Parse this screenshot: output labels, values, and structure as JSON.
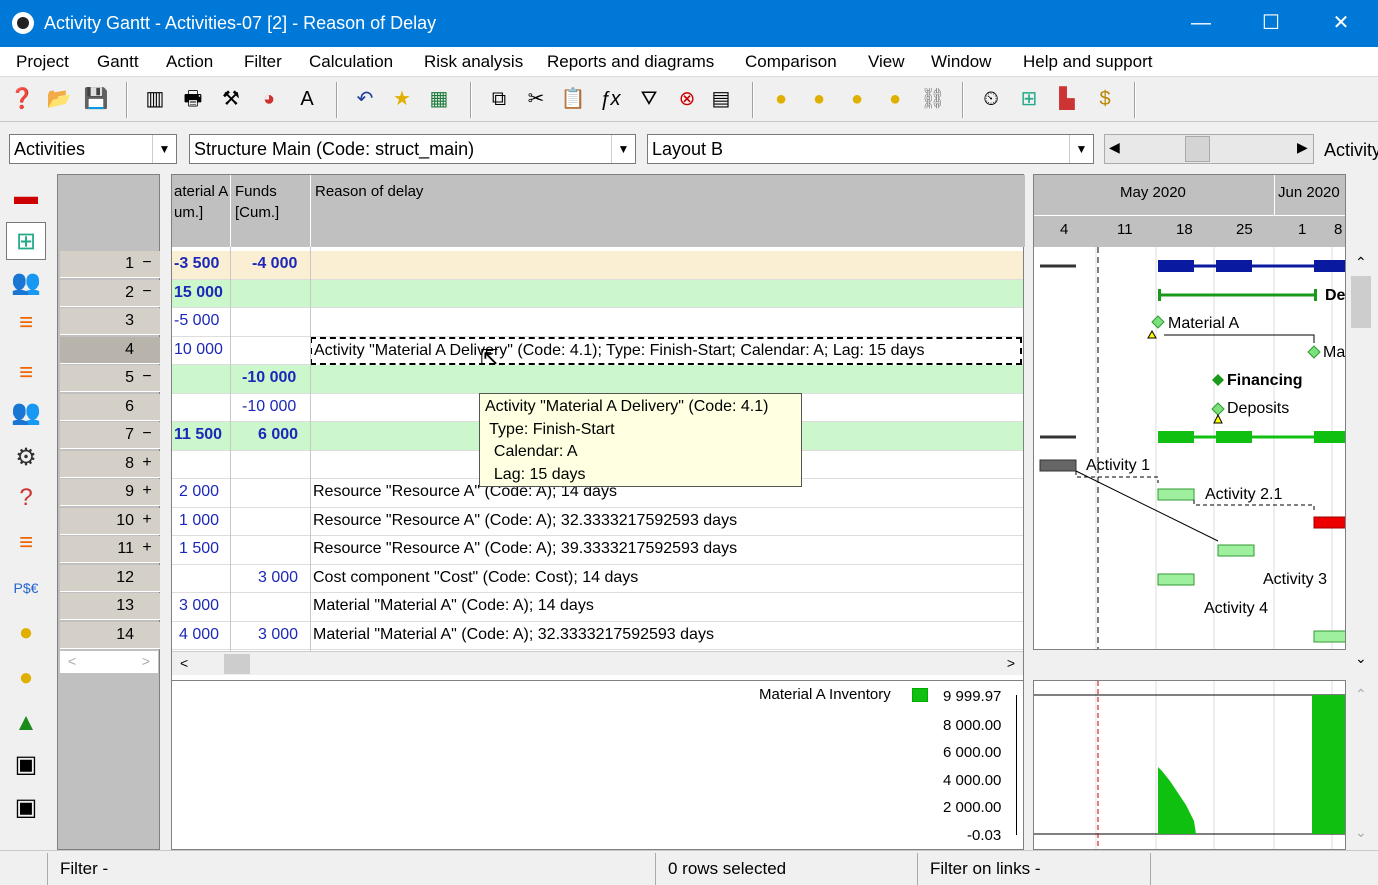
{
  "window": {
    "title": "Activity Gantt - Activities-07 [2] - Reason of Delay",
    "minimize": "—",
    "maximize": "☐",
    "close": "✕"
  },
  "menu": [
    "Project",
    "Gantt",
    "Action",
    "Filter",
    "Calculation",
    "Risk analysis",
    "Reports and diagrams",
    "Comparison",
    "View",
    "Window",
    "Help and support"
  ],
  "combos": {
    "view": "Activities",
    "structure": "Structure Main (Code: struct_main)",
    "layout": "Layout B",
    "right_label": "Activity"
  },
  "columns": {
    "material": "aterial A\num.]",
    "funds": "Funds\n[Cum.]",
    "reason": "Reason of delay"
  },
  "rows": [
    {
      "num": "1",
      "pm": "−",
      "material": "-3 500",
      "funds": "-4 000",
      "reason": ""
    },
    {
      "num": "2",
      "pm": "−",
      "material": "15 000",
      "funds": "",
      "reason": ""
    },
    {
      "num": "3",
      "pm": "",
      "material": "-5 000",
      "funds": "",
      "reason": ""
    },
    {
      "num": "4",
      "pm": "",
      "material": "10 000",
      "funds": "",
      "reason": "Activity \"Material A Delivery\" (Code: 4.1); Type: Finish-Start;  Calendar: A;  Lag: 15 days"
    },
    {
      "num": "5",
      "pm": "−",
      "material": "",
      "funds": "-10 000",
      "reason": ""
    },
    {
      "num": "6",
      "pm": "",
      "material": "",
      "funds": "-10 000",
      "reason": ""
    },
    {
      "num": "7",
      "pm": "−",
      "material": "11 500",
      "funds": "6 000",
      "reason": ""
    },
    {
      "num": "8",
      "pm": "+",
      "material": "",
      "funds": "",
      "reason": ""
    },
    {
      "num": "9",
      "pm": "+",
      "material": "2 000",
      "funds": "",
      "reason": "Resource \"Resource A\" (Code: A); 14 days"
    },
    {
      "num": "10",
      "pm": "+",
      "material": "1 000",
      "funds": "",
      "reason": "Resource \"Resource A\" (Code: A); 32.3333217592593 days"
    },
    {
      "num": "11",
      "pm": "+",
      "material": "1 500",
      "funds": "",
      "reason": "Resource \"Resource A\" (Code: A); 39.3333217592593 days"
    },
    {
      "num": "12",
      "pm": "",
      "material": "",
      "funds": "3 000",
      "reason": "Cost component \"Cost\" (Code: Cost); 14 days"
    },
    {
      "num": "13",
      "pm": "",
      "material": "3 000",
      "funds": "",
      "reason": "Material \"Material A\" (Code: A); 14 days"
    },
    {
      "num": "14",
      "pm": "",
      "material": "4 000",
      "funds": "3 000",
      "reason": "Material \"Material A\" (Code: A); 32.3333217592593 days"
    }
  ],
  "tooltip": "Activity \"Material A Delivery\" (Code: 4.1)\n Type: Finish-Start\n  Calendar: A\n  Lag: 15 days",
  "gantt": {
    "months": [
      "May 2020",
      "Jun 2020"
    ],
    "days": [
      "4",
      "11",
      "18",
      "25",
      "1",
      "8"
    ],
    "labels": [
      "De",
      "Material A",
      "Ma",
      "Financing",
      "Deposits",
      "Activity 1",
      "Activity 2.1",
      "Activity 3",
      "Activity 4"
    ]
  },
  "chart_legend": "Material A Inventory",
  "chart_axis": [
    "9 999.97",
    "8 000.00",
    "6 000.00",
    "4 000.00",
    "2 000.00",
    "-0.03"
  ],
  "status": {
    "filter": "Filter -",
    "rows_selected": "0 rows selected",
    "filter_links": "Filter on links -"
  }
}
